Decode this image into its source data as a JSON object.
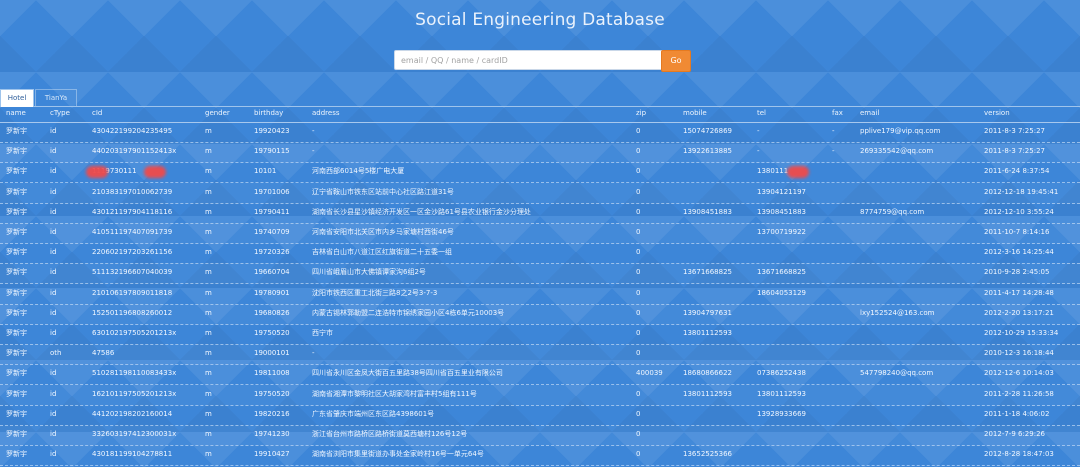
{
  "header": {
    "title": "Social Engineering Database"
  },
  "search": {
    "placeholder": "email / QQ / name / cardID",
    "value": "",
    "button_label": "Go"
  },
  "tabs": [
    {
      "label": "Hotel",
      "active": true
    },
    {
      "label": "TianYa",
      "active": false
    }
  ],
  "table": {
    "columns": [
      "name",
      "cType",
      "cId",
      "gender",
      "birthday",
      "address",
      "zip",
      "mobile",
      "tel",
      "fax",
      "email",
      "version"
    ],
    "rows": [
      [
        "罗新宇",
        "id",
        "430422199204235495",
        "m",
        "19920423",
        "-",
        "0",
        "15074726869",
        "-",
        "-",
        "pplive179@vip.qq.com",
        "2011-8-3 7:25:27"
      ],
      [
        "罗新宇",
        "id",
        "440203197901152413x",
        "m",
        "19790115",
        "-",
        "0",
        "13922613885",
        "-",
        "-",
        "269335542@qq.com",
        "2011-8-3 7:25:27"
      ],
      [
        "罗新宇",
        "id",
        "1119730111",
        "m",
        "10101",
        "河南西部6014号5楼广电大厦",
        "0",
        "",
        "1380111",
        "",
        "",
        "2011-6-24 8:37:54"
      ],
      [
        "罗新宇",
        "id",
        "210383197010062739",
        "m",
        "19701006",
        "辽宁省鞍山市铁东区站前中心社区路江道31号",
        "0",
        "",
        "13904121197",
        "",
        "",
        "2012-12-18 19:45:41"
      ],
      [
        "罗新宇",
        "id",
        "430121197904118116",
        "m",
        "19790411",
        "湖南省长沙县星沙镇经济开发区一区金沙路61号县农业银行金沙分理处",
        "0",
        "13908451883",
        "13908451883",
        "",
        "8774759@qq.com",
        "2012-12-10 3:55:24"
      ],
      [
        "罗新宇",
        "id",
        "410511197407091739",
        "m",
        "19740709",
        "河南省安阳市北关区市内乡马家塘村西街46号",
        "0",
        "",
        "13700719922",
        "",
        "",
        "2011-10-7 8:14:16"
      ],
      [
        "罗新宇",
        "id",
        "220602197203261156",
        "m",
        "19720326",
        "吉林省白山市八道江区红旗街道二十五委一组",
        "0",
        "",
        "",
        "",
        "",
        "2012-3-16 14:25:44"
      ],
      [
        "罗新宇",
        "id",
        "511132196607040039",
        "m",
        "19660704",
        "四川省峨眉山市大佛镇谭家沟6组2号",
        "0",
        "13671668825",
        "13671668825",
        "",
        "",
        "2010-9-28 2:45:05"
      ],
      [
        "罗新宇",
        "id",
        "210106197809011818",
        "m",
        "19780901",
        "沈阳市铁西区重工北街三路8之2号3-7-3",
        "0",
        "",
        "18604053129",
        "",
        "",
        "2011-4-17 14:28:48"
      ],
      [
        "罗新宇",
        "id",
        "152501196808260012",
        "m",
        "19680826",
        "内蒙古锡林郭勒盟二连浩特市锦绣家园小区4栋6单元10003号",
        "0",
        "13904797631",
        "",
        "",
        "lxy152524@163.com",
        "2012-2-20 13:17:21"
      ],
      [
        "罗新宇",
        "id",
        "630102197505201213x",
        "m",
        "19750520",
        "西宁市",
        "0",
        "13801112593",
        "",
        "",
        "",
        "2012-10-29 15:33:34"
      ],
      [
        "罗新宇",
        "oth",
        "47586",
        "m",
        "19000101",
        "-",
        "0",
        "",
        "",
        "",
        "",
        "2010-12-3 16:18:44"
      ],
      [
        "罗新宇",
        "id",
        "510281198110083433x",
        "m",
        "19811008",
        "四川省永川区金凤大街百五里路38号四川省百五里业有限公司",
        "400039",
        "18680866622",
        "07386252438",
        "",
        "547798240@qq.com",
        "2012-12-6 10:14:03"
      ],
      [
        "罗新宇",
        "id",
        "162101197505201213x",
        "m",
        "19750520",
        "湖南省湘潭市黎明社区大胡家湾村富丰村5组有111号",
        "0",
        "13801112593",
        "13801112593",
        "",
        "",
        "2011-2-28 11:26:58"
      ],
      [
        "罗新宇",
        "id",
        "441202198202160014",
        "m",
        "19820216",
        "广东省肇庆市端州区东区路4398601号",
        "0",
        "",
        "13928933669",
        "",
        "",
        "2011-1-18 4:06:02"
      ],
      [
        "罗新宇",
        "id",
        "332603197412300031x",
        "m",
        "19741230",
        "浙江省台州市路桥区路桥街道莫西塘村126号12号",
        "0",
        "",
        "",
        "",
        "",
        "2012-7-9 6:29:26"
      ],
      [
        "罗新宇",
        "id",
        "430181199104278811",
        "m",
        "19910427",
        "湖南省浏阳市集里街道办事处金家岭村16号一单元64号",
        "0",
        "13652525366",
        "",
        "",
        "",
        "2012-8-28 18:47:03"
      ]
    ]
  }
}
